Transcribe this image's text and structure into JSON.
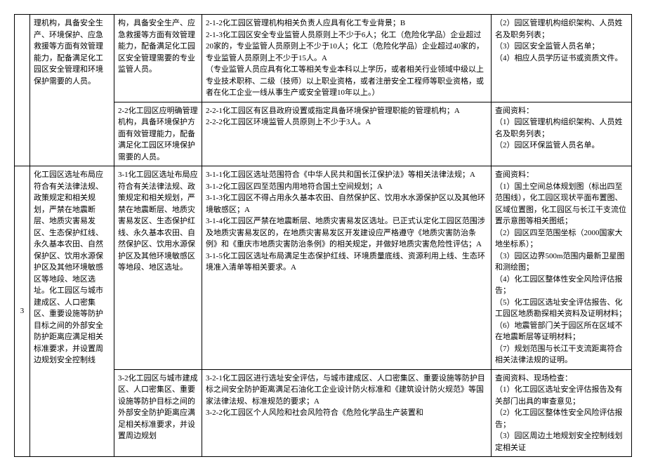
{
  "rows": [
    {
      "num": "",
      "req": "理机构，具备安全生产、环境保护、应急救援等方面有效管理能力，配备满足化工园区安全管理和环境保护需要的人员。",
      "sub": "构，具备安全生产、应急救援等方面有效管理能力，配备满足化工园区安全管理需要的专业监管人员。",
      "detail": "2-1-2化工园区管理机构相关负责人应具有化工专业背景；B\n2-1-3化工园区安全专业监管人员原则上不少于6人；化工（危险化学品）企业超过20家的，专业监管人员原则上不少于10人；化工（危险化学品）企业超过40家的，专业监管人员原则上不少于15人。A\n（专业监管人员应具有化工等相关专业本科以上学历，或者相关行业领域中级以上专业技术职称、二级（技师）以上职业资格，或者注册安全工程师等职业资格，或者在化工企业一线从事生产或安全管理10年以上。）",
      "check": "（2）园区管理机构组织架构、人员姓名及职务列表；\n（3）园区安全监管人员名单；\n（4）相应人员学历证书或资质文件。"
    },
    {
      "num": "",
      "req": "",
      "sub": "2-2化工园区应明确管理机构，具备环境保护方面有效管理能力，配备满足化工园区环境保护需要的人员。",
      "detail": "2-2-1化工园区有区县政府设置或指定具备环境保护管理职能的管理机构；A\n2-2-2化工园区环境监管人员原则上不少于3人。A",
      "check": "查阅资料：\n（1）园区管理机构组织架构、人员姓名及职务列表；\n（2）园区环保监管人员名单。"
    },
    {
      "num": "3",
      "req": "化工园区选址布局应符合有关法律法规、政策规定和相关规划，严禁在地震断层、地质灾害易发区、生态保护红线、永久基本农田、自然保护区、饮用水源保护区及其他环境敏感区等地段、地区选址。化工园区与城市建成区、人口密集区、重要设施等防护目标之间的外部安全防护距离应满足相关标准要求，并设置周边规划安全控制线",
      "sub": "3-1化工园区选址布局应符合有关法律法规、政策规定和相关规划，严禁在地震断层、地质灾害易发区、生态保护红线、永久基本农田、自然保护区、饮用水源保护区及其他环境敏感区等地段、地区选址。",
      "detail": "3-1-1化工园区选址范围符合《中华人民共和国长江保护法》等相关法律法规；A\n3-1-2化工园区四至范围内用地符合国土空间规划；A\n3-1-3化工园区不得占用永久基本农田、自然保护区、饮用水水源保护区以及其他环境敏感区；A\n3-1-4化工园区严禁在地震断层、地质灾害易发区选址。已正式认定化工园区范围涉及地质灾害易发区的，在地质灾害易发区开发建设应严格遵守《地质灾害防治条例》和《重庆市地质灾害防治条例》的相关规定，并做好地质灾害危险性评估；A\n3-1-5化工园区选址布局满足生态保护红线、环境质量底线、资源利用上线、生态环境准入清单等相关要求。A",
      "check": "查阅资料：\n（1）国土空间总体规划图（标出四至范围线），化工园区现状平面布置图、区域位置图，化工园区与长江干支流位置示意图等相关图纸；\n（2）园区四至范围坐标（2000国家大地坐标系）；\n（3）园区边界500m范围内最新卫星图和测绘图；\n（4）化工园区整体性安全风险评估报告；\n（5）化工园区选址安全评估报告、化工园区地质勘探相关资料及证明材料；\n（6）地震管部门关于园区所在区域不在地震断层等证明材料；\n（7）规划范围与长江干支流距离符合相关法律法规的证明。"
    },
    {
      "num": "",
      "req": "",
      "sub": "3-2化工园区与城市建成区、人口密集区、重要设施等防护目标之间的外部安全防护距离应满足相关标准要求，并设置周边规划",
      "detail": "3-2-1化工园区进行选址安全评估，与城市建成区、人口密集区、重要设施等防护目标之间安全防护距离满足石油化工企业设计防火标准和《建筑设计防火规范》等国家法律法规、标准规范的要求；A\n3-2-2化工园区个人风险和社会风险符合《危险化学品生产装置和",
      "check": "查阅资料、现场检查：\n（1）化工园区选址安全评估报告及有关部门出具的审查意见；\n（2）化工园区整体性安全风险评估报告；\n（3）园区周边土地规划安全控制线划定相关证"
    }
  ]
}
